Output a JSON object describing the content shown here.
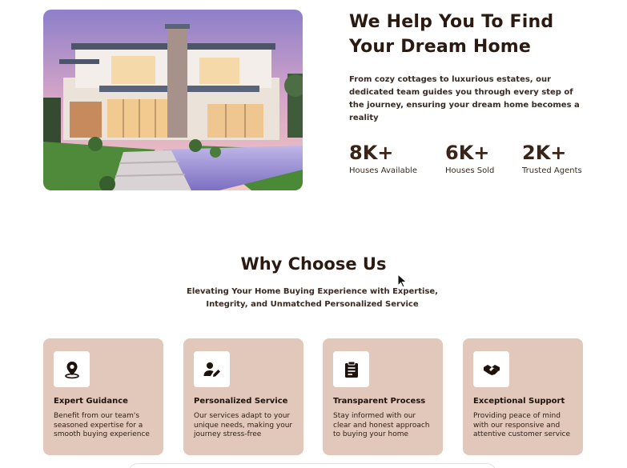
{
  "hero": {
    "title_line1": "We Help You To Find",
    "title_line2": "Your Dream Home",
    "description": "From cozy cottages to luxurious estates, our dedicated team guides you through every step of the journey, ensuring your dream home becomes a reality",
    "image_icon": "modern-house-photo"
  },
  "stats": [
    {
      "value": "8K+",
      "label": "Houses Available"
    },
    {
      "value": "6K+",
      "label": "Houses Sold"
    },
    {
      "value": "2K+",
      "label": "Trusted Agents"
    }
  ],
  "why": {
    "title": "Why Choose Us",
    "subtitle": "Elevating Your Home Buying Experience with Expertise, Integrity, and Unmatched Personalized Service"
  },
  "cards": [
    {
      "icon": "map-pin-icon",
      "title": "Expert Guidance",
      "description": "Benefit from our team's seasoned expertise for a smooth buying experience"
    },
    {
      "icon": "user-edit-icon",
      "title": "Personalized Service",
      "description": "Our services adapt to your unique needs, making your journey stress-free"
    },
    {
      "icon": "clipboard-icon",
      "title": "Transparent Process",
      "description": "Stay informed with our clear and honest approach to buying your home"
    },
    {
      "icon": "handshake-icon",
      "title": "Exceptional Support",
      "description": "Providing peace of mind with our responsive and attentive customer service"
    }
  ],
  "colors": {
    "accent_card": "#e2c8ba",
    "heading": "#2b1a12",
    "stat_value": "#3a2418"
  }
}
